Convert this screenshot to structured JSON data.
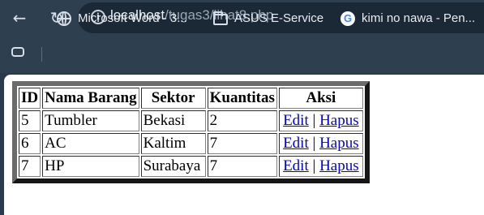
{
  "browser": {
    "url_host": "localhost",
    "url_path": "/tugas3/lihat8.php",
    "bookmarks": [
      {
        "label": "Microsoft Word - 3...",
        "icon": "globe-icon"
      },
      {
        "label": "ASUS E-Service",
        "icon": "folder-icon"
      },
      {
        "label": "kimi no nawa - Pen...",
        "icon": "google-icon"
      }
    ]
  },
  "table": {
    "headers": [
      "ID",
      "Nama Barang",
      "Sektor",
      "Kuantitas",
      "Aksi"
    ],
    "rows": [
      {
        "id": "5",
        "nama": "Tumbler",
        "sektor": "Bekasi",
        "kuantitas": "2"
      },
      {
        "id": "6",
        "nama": "AC",
        "sektor": "Kaltim",
        "kuantitas": "7"
      },
      {
        "id": "7",
        "nama": "HP",
        "sektor": "Surabaya",
        "kuantitas": "7"
      }
    ],
    "edit_label": "Edit",
    "separator": "|",
    "delete_label": "Hapus"
  }
}
